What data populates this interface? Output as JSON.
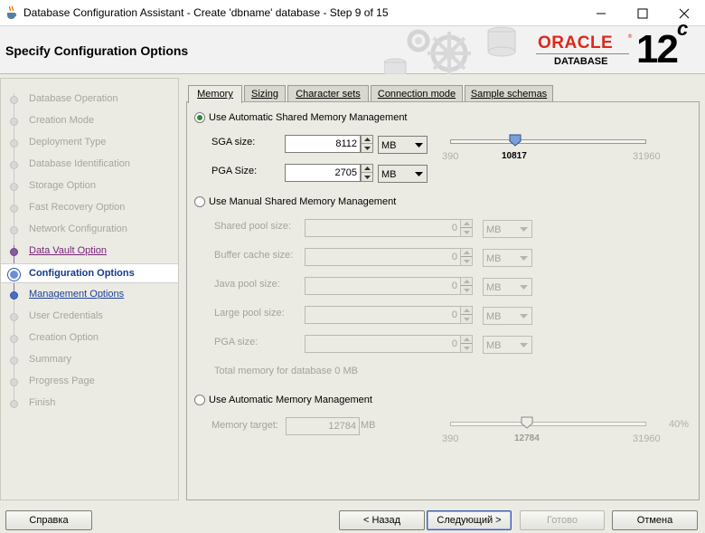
{
  "window": {
    "title": "Database Configuration Assistant - Create 'dbname' database - Step 9 of 15"
  },
  "header": {
    "page_title": "Specify Configuration Options",
    "brand_word": "ORACLE",
    "brand_reg": "®",
    "brand_sub": "DATABASE",
    "version_num": "12",
    "version_suffix": "c"
  },
  "nav": {
    "items": [
      {
        "label": "Database Operation",
        "state": "disabled"
      },
      {
        "label": "Creation Mode",
        "state": "disabled"
      },
      {
        "label": "Deployment Type",
        "state": "disabled"
      },
      {
        "label": "Database Identification",
        "state": "disabled"
      },
      {
        "label": "Storage Option",
        "state": "disabled"
      },
      {
        "label": "Fast Recovery Option",
        "state": "disabled"
      },
      {
        "label": "Network Configuration",
        "state": "disabled"
      },
      {
        "label": "Data Vault Option",
        "state": "visited"
      },
      {
        "label": "Configuration Options",
        "state": "current"
      },
      {
        "label": "Management Options",
        "state": "next"
      },
      {
        "label": "User Credentials",
        "state": "disabled"
      },
      {
        "label": "Creation Option",
        "state": "disabled"
      },
      {
        "label": "Summary",
        "state": "disabled"
      },
      {
        "label": "Progress Page",
        "state": "disabled"
      },
      {
        "label": "Finish",
        "state": "disabled"
      }
    ]
  },
  "tabs": [
    {
      "label": "Memory",
      "active": true
    },
    {
      "label": "Sizing",
      "active": false
    },
    {
      "label": "Character sets",
      "active": false
    },
    {
      "label": "Connection mode",
      "active": false
    },
    {
      "label": "Sample schemas",
      "active": false
    }
  ],
  "memory": {
    "auto_shared": {
      "label": "Use Automatic Shared Memory Management",
      "selected": true,
      "sga_label": "SGA size:",
      "sga_value": "8112",
      "sga_unit": "MB",
      "pga_label": "PGA Size:",
      "pga_value": "2705",
      "pga_unit": "MB",
      "slider_min": "390",
      "slider_max": "31960",
      "slider_value": "10817",
      "slider_level": 10817
    },
    "manual_shared": {
      "label": "Use Manual Shared Memory Management",
      "selected": false,
      "fields": [
        {
          "label": "Shared pool size:",
          "value": "0",
          "unit": "MB"
        },
        {
          "label": "Buffer cache size:",
          "value": "0",
          "unit": "MB"
        },
        {
          "label": "Java pool size:",
          "value": "0",
          "unit": "MB"
        },
        {
          "label": "Large pool size:",
          "value": "0",
          "unit": "MB"
        },
        {
          "label": "PGA size:",
          "value": "0",
          "unit": "MB"
        }
      ],
      "total_text": "Total memory for database 0 MB"
    },
    "auto_memory": {
      "label": "Use Automatic Memory Management",
      "selected": false,
      "target_label": "Memory target:",
      "target_value": "12784",
      "target_unit": "MB",
      "slider_min": "390",
      "slider_max": "31960",
      "slider_value": "12784",
      "slider_level": 12784,
      "percent": "40%"
    }
  },
  "footer": {
    "help_label": "Справка",
    "back_label": "< Назад",
    "next_label": "Следующий >",
    "finish_label": "Готово",
    "cancel_label": "Отмена"
  },
  "colors": {
    "oracle_red": "#e0261a",
    "nav_visited": "#7a237a",
    "nav_current": "#123a8c",
    "radio_selected": "#2e8a3a"
  }
}
